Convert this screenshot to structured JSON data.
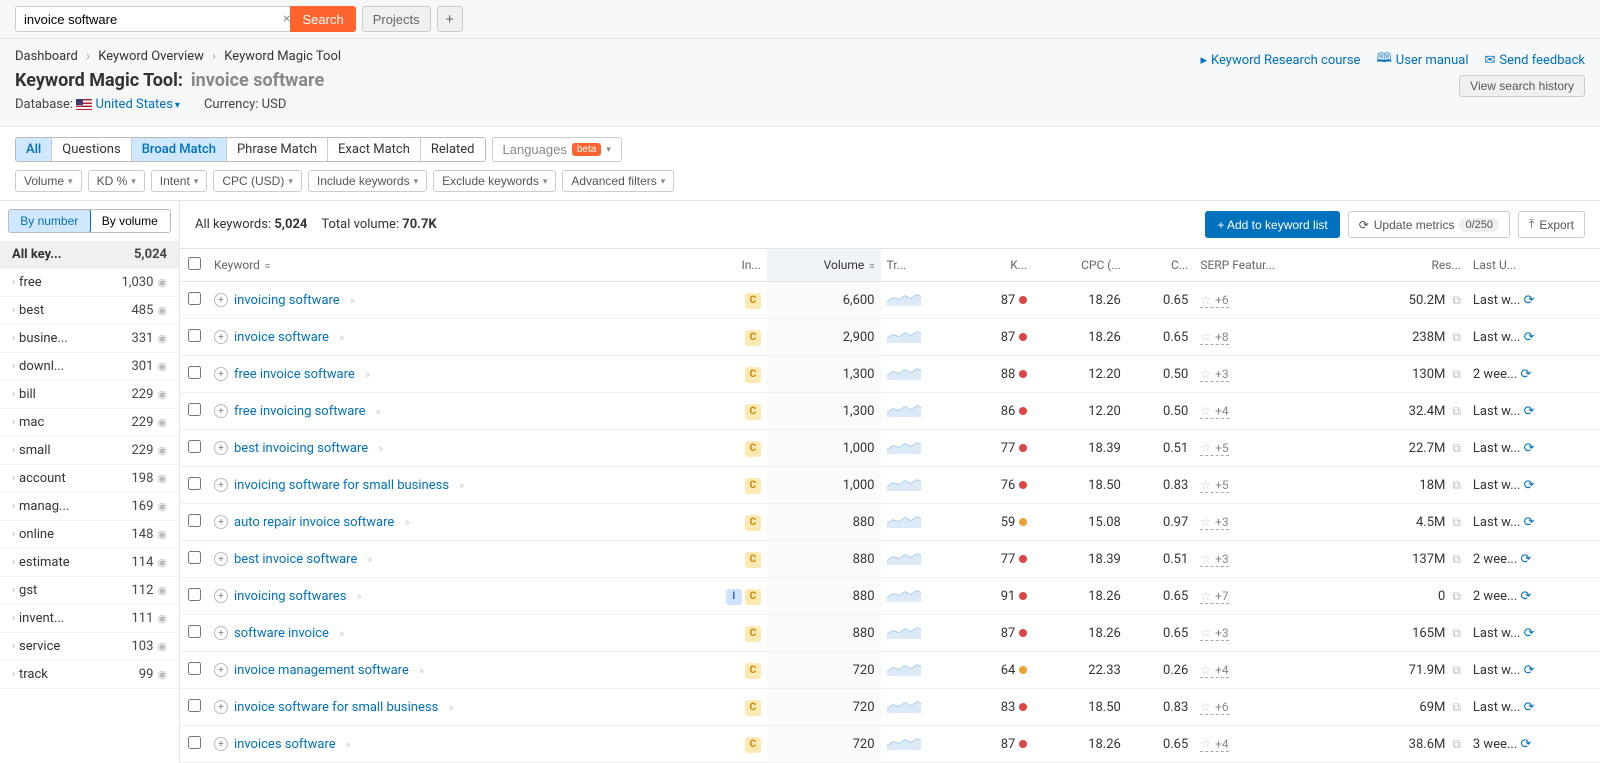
{
  "search": {
    "value": "invoice software",
    "button": "Search",
    "projects": "Projects"
  },
  "breadcrumb": [
    "Dashboard",
    "Keyword Overview",
    "Keyword Magic Tool"
  ],
  "header_links": [
    {
      "icon": "▶",
      "label": "Keyword Research course"
    },
    {
      "icon": "🕮",
      "label": "User manual"
    },
    {
      "icon": "✉",
      "label": "Send feedback"
    }
  ],
  "title": {
    "tool": "Keyword Magic Tool:",
    "query": "invoice software",
    "history_btn": "View search history"
  },
  "meta": {
    "db_label": "Database:",
    "db_value": "United States",
    "currency_label": "Currency:",
    "currency_value": "USD"
  },
  "match_tabs": [
    "All",
    "Questions",
    "Broad Match",
    "Phrase Match",
    "Exact Match",
    "Related"
  ],
  "active_tabs": [
    "All",
    "Broad Match"
  ],
  "lang_btn": "Languages",
  "lang_badge": "beta",
  "filters": [
    "Volume",
    "KD %",
    "Intent",
    "CPC (USD)",
    "Include keywords",
    "Exclude keywords",
    "Advanced filters"
  ],
  "view_toggle": {
    "by_number": "By number",
    "by_volume": "By volume"
  },
  "side_header": {
    "label": "All key...",
    "count": "5,024"
  },
  "side_items": [
    {
      "label": "free",
      "count": "1,030"
    },
    {
      "label": "best",
      "count": "485"
    },
    {
      "label": "busine...",
      "count": "331"
    },
    {
      "label": "downl...",
      "count": "301"
    },
    {
      "label": "bill",
      "count": "229"
    },
    {
      "label": "mac",
      "count": "229"
    },
    {
      "label": "small",
      "count": "229"
    },
    {
      "label": "account",
      "count": "198"
    },
    {
      "label": "manag...",
      "count": "169"
    },
    {
      "label": "online",
      "count": "148"
    },
    {
      "label": "estimate",
      "count": "114"
    },
    {
      "label": "gst",
      "count": "112"
    },
    {
      "label": "invent...",
      "count": "111"
    },
    {
      "label": "service",
      "count": "103"
    },
    {
      "label": "track",
      "count": "99"
    }
  ],
  "stats": {
    "all_kw_label": "All keywords:",
    "all_kw_val": "5,024",
    "vol_label": "Total volume:",
    "vol_val": "70.7K"
  },
  "actions": {
    "add": "+  Add to keyword list",
    "update": "Update metrics",
    "update_count": "0/250",
    "export": "Export"
  },
  "columns": [
    "",
    "Keyword",
    "In...",
    "Volume",
    "Tr...",
    "K...",
    "CPC (...",
    "C...",
    "SERP Featur...",
    "Res...",
    "Last U..."
  ],
  "rows": [
    {
      "kw": "invoicing software",
      "intent": [
        "C"
      ],
      "vol": "6,600",
      "kd": 87,
      "kdc": "red",
      "cpc": "18.26",
      "cd": "0.65",
      "serp": "+6",
      "res": "50.2M",
      "upd": "Last w..."
    },
    {
      "kw": "invoice software",
      "intent": [
        "C"
      ],
      "vol": "2,900",
      "kd": 87,
      "kdc": "red",
      "cpc": "18.26",
      "cd": "0.65",
      "serp": "+8",
      "res": "238M",
      "upd": "Last w..."
    },
    {
      "kw": "free invoice software",
      "intent": [
        "C"
      ],
      "vol": "1,300",
      "kd": 88,
      "kdc": "red",
      "cpc": "12.20",
      "cd": "0.50",
      "serp": "+3",
      "res": "130M",
      "upd": "2 wee..."
    },
    {
      "kw": "free invoicing software",
      "intent": [
        "C"
      ],
      "vol": "1,300",
      "kd": 86,
      "kdc": "red",
      "cpc": "12.20",
      "cd": "0.50",
      "serp": "+4",
      "res": "32.4M",
      "upd": "Last w..."
    },
    {
      "kw": "best invoicing software",
      "intent": [
        "C"
      ],
      "vol": "1,000",
      "kd": 77,
      "kdc": "red",
      "cpc": "18.39",
      "cd": "0.51",
      "serp": "+5",
      "res": "22.7M",
      "upd": "Last w..."
    },
    {
      "kw": "invoicing software for small business",
      "intent": [
        "C"
      ],
      "vol": "1,000",
      "kd": 76,
      "kdc": "red",
      "cpc": "18.50",
      "cd": "0.83",
      "serp": "+5",
      "res": "18M",
      "upd": "Last w..."
    },
    {
      "kw": "auto repair invoice software",
      "intent": [
        "C"
      ],
      "vol": "880",
      "kd": 59,
      "kdc": "orange",
      "cpc": "15.08",
      "cd": "0.97",
      "serp": "+3",
      "res": "4.5M",
      "upd": "Last w..."
    },
    {
      "kw": "best invoice software",
      "intent": [
        "C"
      ],
      "vol": "880",
      "kd": 77,
      "kdc": "red",
      "cpc": "18.39",
      "cd": "0.51",
      "serp": "+3",
      "res": "137M",
      "upd": "2 wee..."
    },
    {
      "kw": "invoicing softwares",
      "intent": [
        "I",
        "C"
      ],
      "vol": "880",
      "kd": 91,
      "kdc": "red",
      "cpc": "18.26",
      "cd": "0.65",
      "serp": "+7",
      "res": "0",
      "upd": "2 wee..."
    },
    {
      "kw": "software invoice",
      "intent": [
        "C"
      ],
      "vol": "880",
      "kd": 87,
      "kdc": "red",
      "cpc": "18.26",
      "cd": "0.65",
      "serp": "+3",
      "res": "165M",
      "upd": "Last w..."
    },
    {
      "kw": "invoice management software",
      "intent": [
        "C"
      ],
      "vol": "720",
      "kd": 64,
      "kdc": "orange",
      "cpc": "22.33",
      "cd": "0.26",
      "serp": "+4",
      "res": "71.9M",
      "upd": "Last w..."
    },
    {
      "kw": "invoice software for small business",
      "intent": [
        "C"
      ],
      "vol": "720",
      "kd": 83,
      "kdc": "red",
      "cpc": "18.50",
      "cd": "0.83",
      "serp": "+6",
      "res": "69M",
      "upd": "Last w..."
    },
    {
      "kw": "invoices software",
      "intent": [
        "C"
      ],
      "vol": "720",
      "kd": 87,
      "kdc": "red",
      "cpc": "18.26",
      "cd": "0.65",
      "serp": "+4",
      "res": "38.6M",
      "upd": "3 wee..."
    }
  ]
}
